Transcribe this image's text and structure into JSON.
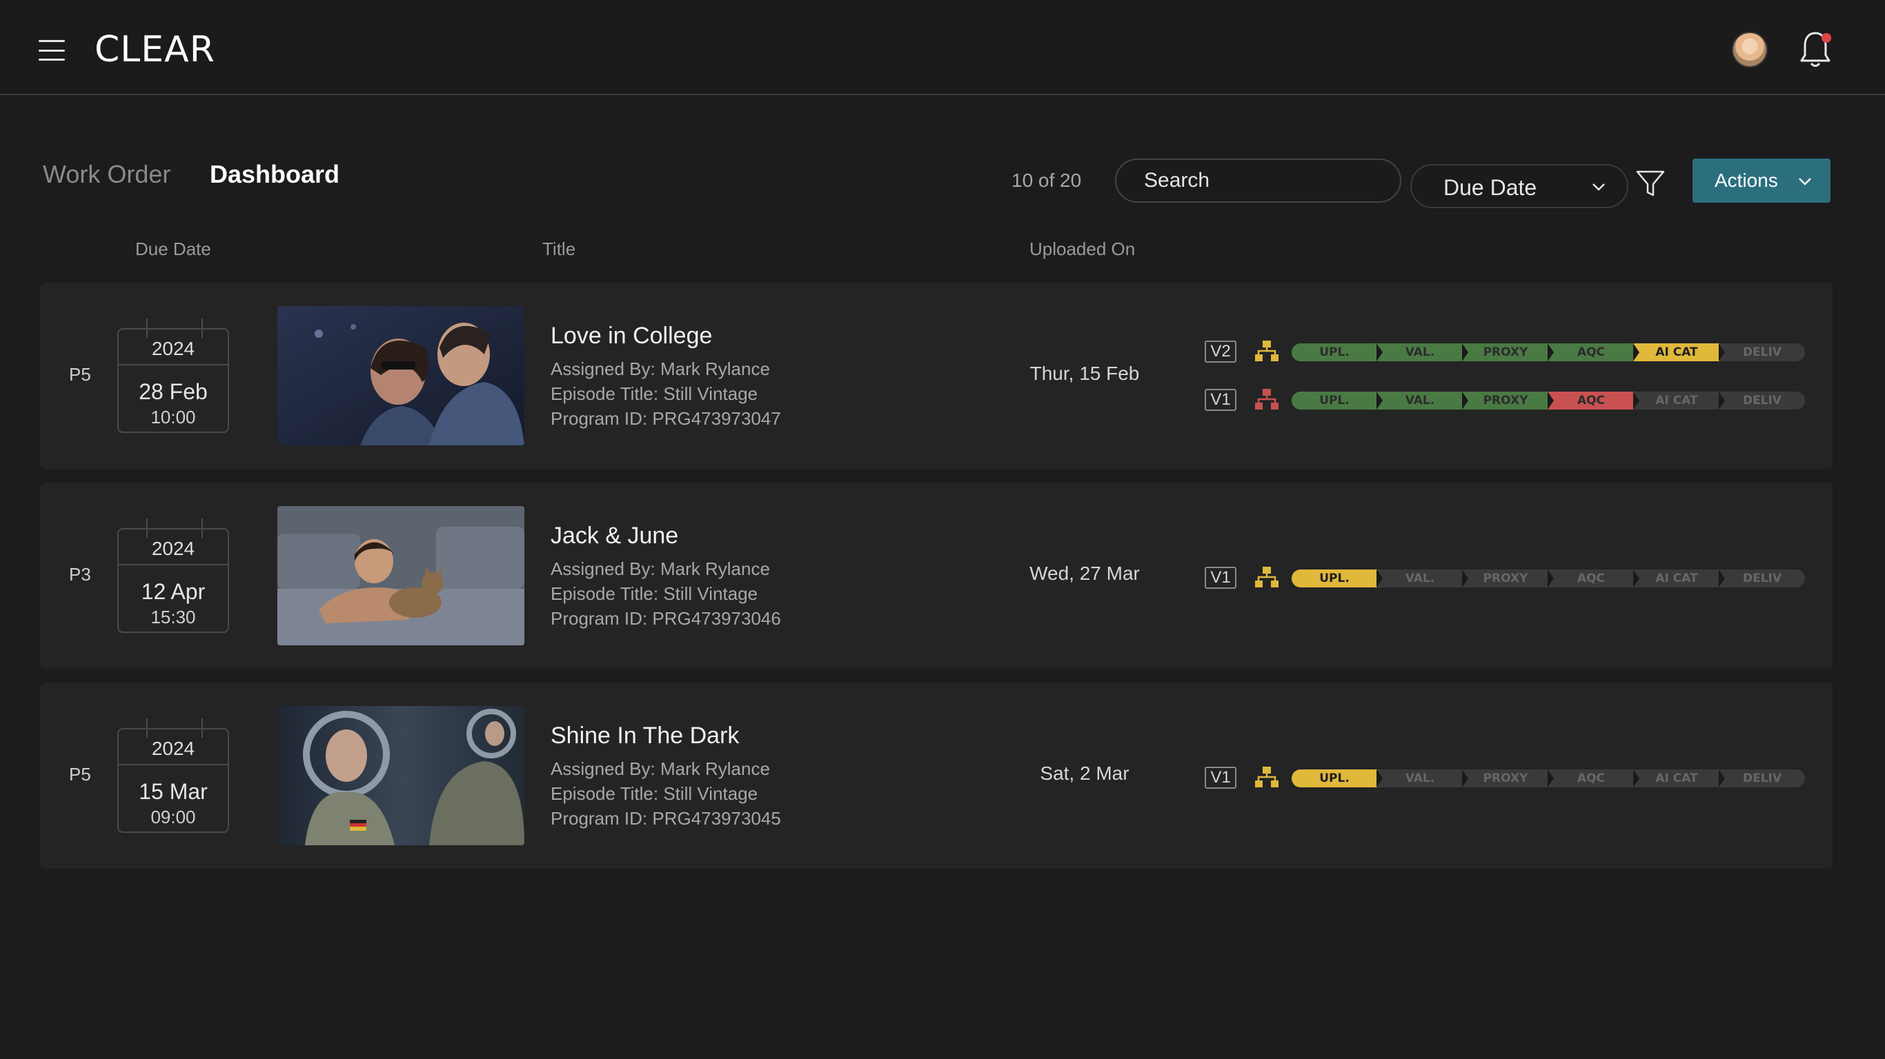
{
  "app": {
    "logo": "CLEAR"
  },
  "header": {
    "avatar_icon": "user-avatar",
    "bell_icon": "bell-icon",
    "notification_dot_color": "#e04545"
  },
  "toolbar": {
    "tabs": [
      {
        "label": "Work Order"
      },
      {
        "label": "Dashboard",
        "active": true
      }
    ],
    "count": "10 of 20",
    "search_placeholder": "Search",
    "sort_selected": "Due Date",
    "actions_label": "Actions",
    "accent_color": "#2b6f7e"
  },
  "columns": {
    "due_date": "Due Date",
    "title": "Title",
    "uploaded_on": "Uploaded On"
  },
  "pipeline_stages": [
    "UPL.",
    "VAL.",
    "PROXY",
    "AQC",
    "AI CAT",
    "DELIV"
  ],
  "status_colors": {
    "complete": "#4a7a44",
    "active": "#e0b83a",
    "failed": "#c95151",
    "pending": "#3a3a3a"
  },
  "work_orders": [
    {
      "priority": "P5",
      "due": {
        "year": "2024",
        "day": "28 Feb",
        "time": "10:00"
      },
      "title": "Love in College",
      "assigned_by": "Assigned By: Mark Rylance",
      "episode_title": "Episode Title: Still Vintage",
      "program_id": "Program ID: PRG473973047",
      "uploaded_on": "Thur, 15 Feb",
      "versions": [
        {
          "label": "V2",
          "tree_color": "#e0b83a",
          "stages": [
            "complete",
            "complete",
            "complete",
            "complete",
            "active",
            "pending"
          ]
        },
        {
          "label": "V1",
          "tree_color": "#c95151",
          "stages": [
            "complete",
            "complete",
            "complete",
            "failed",
            "pending",
            "pending"
          ]
        }
      ]
    },
    {
      "priority": "P3",
      "due": {
        "year": "2024",
        "day": "12 Apr",
        "time": "15:30"
      },
      "title": "Jack & June",
      "assigned_by": "Assigned By: Mark Rylance",
      "episode_title": "Episode Title: Still Vintage",
      "program_id": "Program ID: PRG473973046",
      "uploaded_on": "Wed, 27 Mar",
      "versions": [
        {
          "label": "V1",
          "tree_color": "#e0b83a",
          "stages": [
            "active",
            "pending",
            "pending",
            "pending",
            "pending",
            "pending"
          ]
        }
      ]
    },
    {
      "priority": "P5",
      "due": {
        "year": "2024",
        "day": "15 Mar",
        "time": "09:00"
      },
      "title": "Shine In The Dark",
      "assigned_by": "Assigned By: Mark Rylance",
      "episode_title": "Episode Title: Still Vintage",
      "program_id": "Program ID: PRG473973045",
      "uploaded_on": "Sat, 2 Mar",
      "versions": [
        {
          "label": "V1",
          "tree_color": "#e0b83a",
          "stages": [
            "active",
            "pending",
            "pending",
            "pending",
            "pending",
            "pending"
          ]
        }
      ]
    }
  ]
}
